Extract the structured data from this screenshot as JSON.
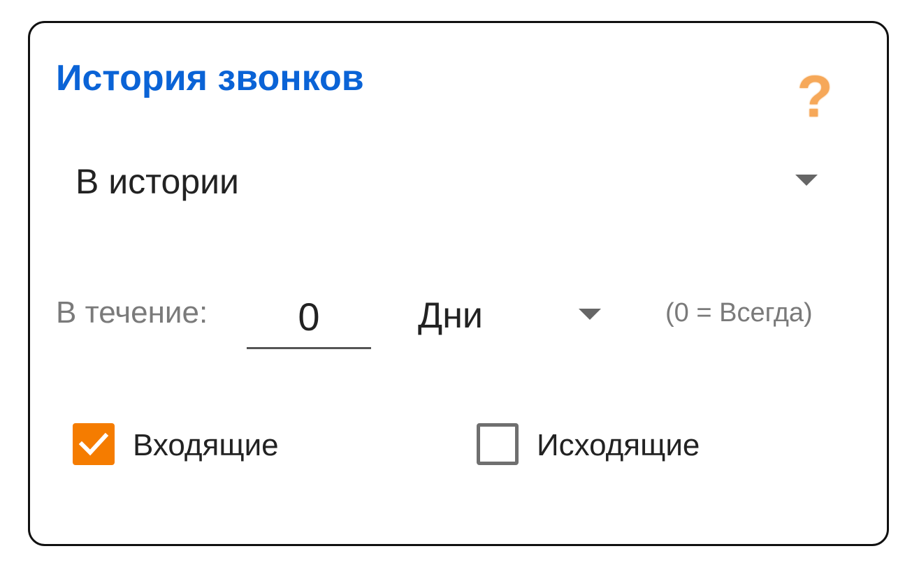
{
  "card": {
    "title": "История звонков",
    "help_icon": "question-mark-icon",
    "colors": {
      "title": "#0a63d6",
      "help_icon": "#f6a859",
      "checkbox_checked": "#f57c00"
    }
  },
  "history_select": {
    "value": "В истории",
    "icon": "dropdown-caret-icon"
  },
  "period": {
    "label": "В течение:",
    "days_value": "0",
    "unit_value": "Дни",
    "hint": "(0 = Всегда)"
  },
  "checkboxes": {
    "incoming": {
      "label": "Входящие",
      "checked": true
    },
    "outgoing": {
      "label": "Исходящие",
      "checked": false
    }
  }
}
